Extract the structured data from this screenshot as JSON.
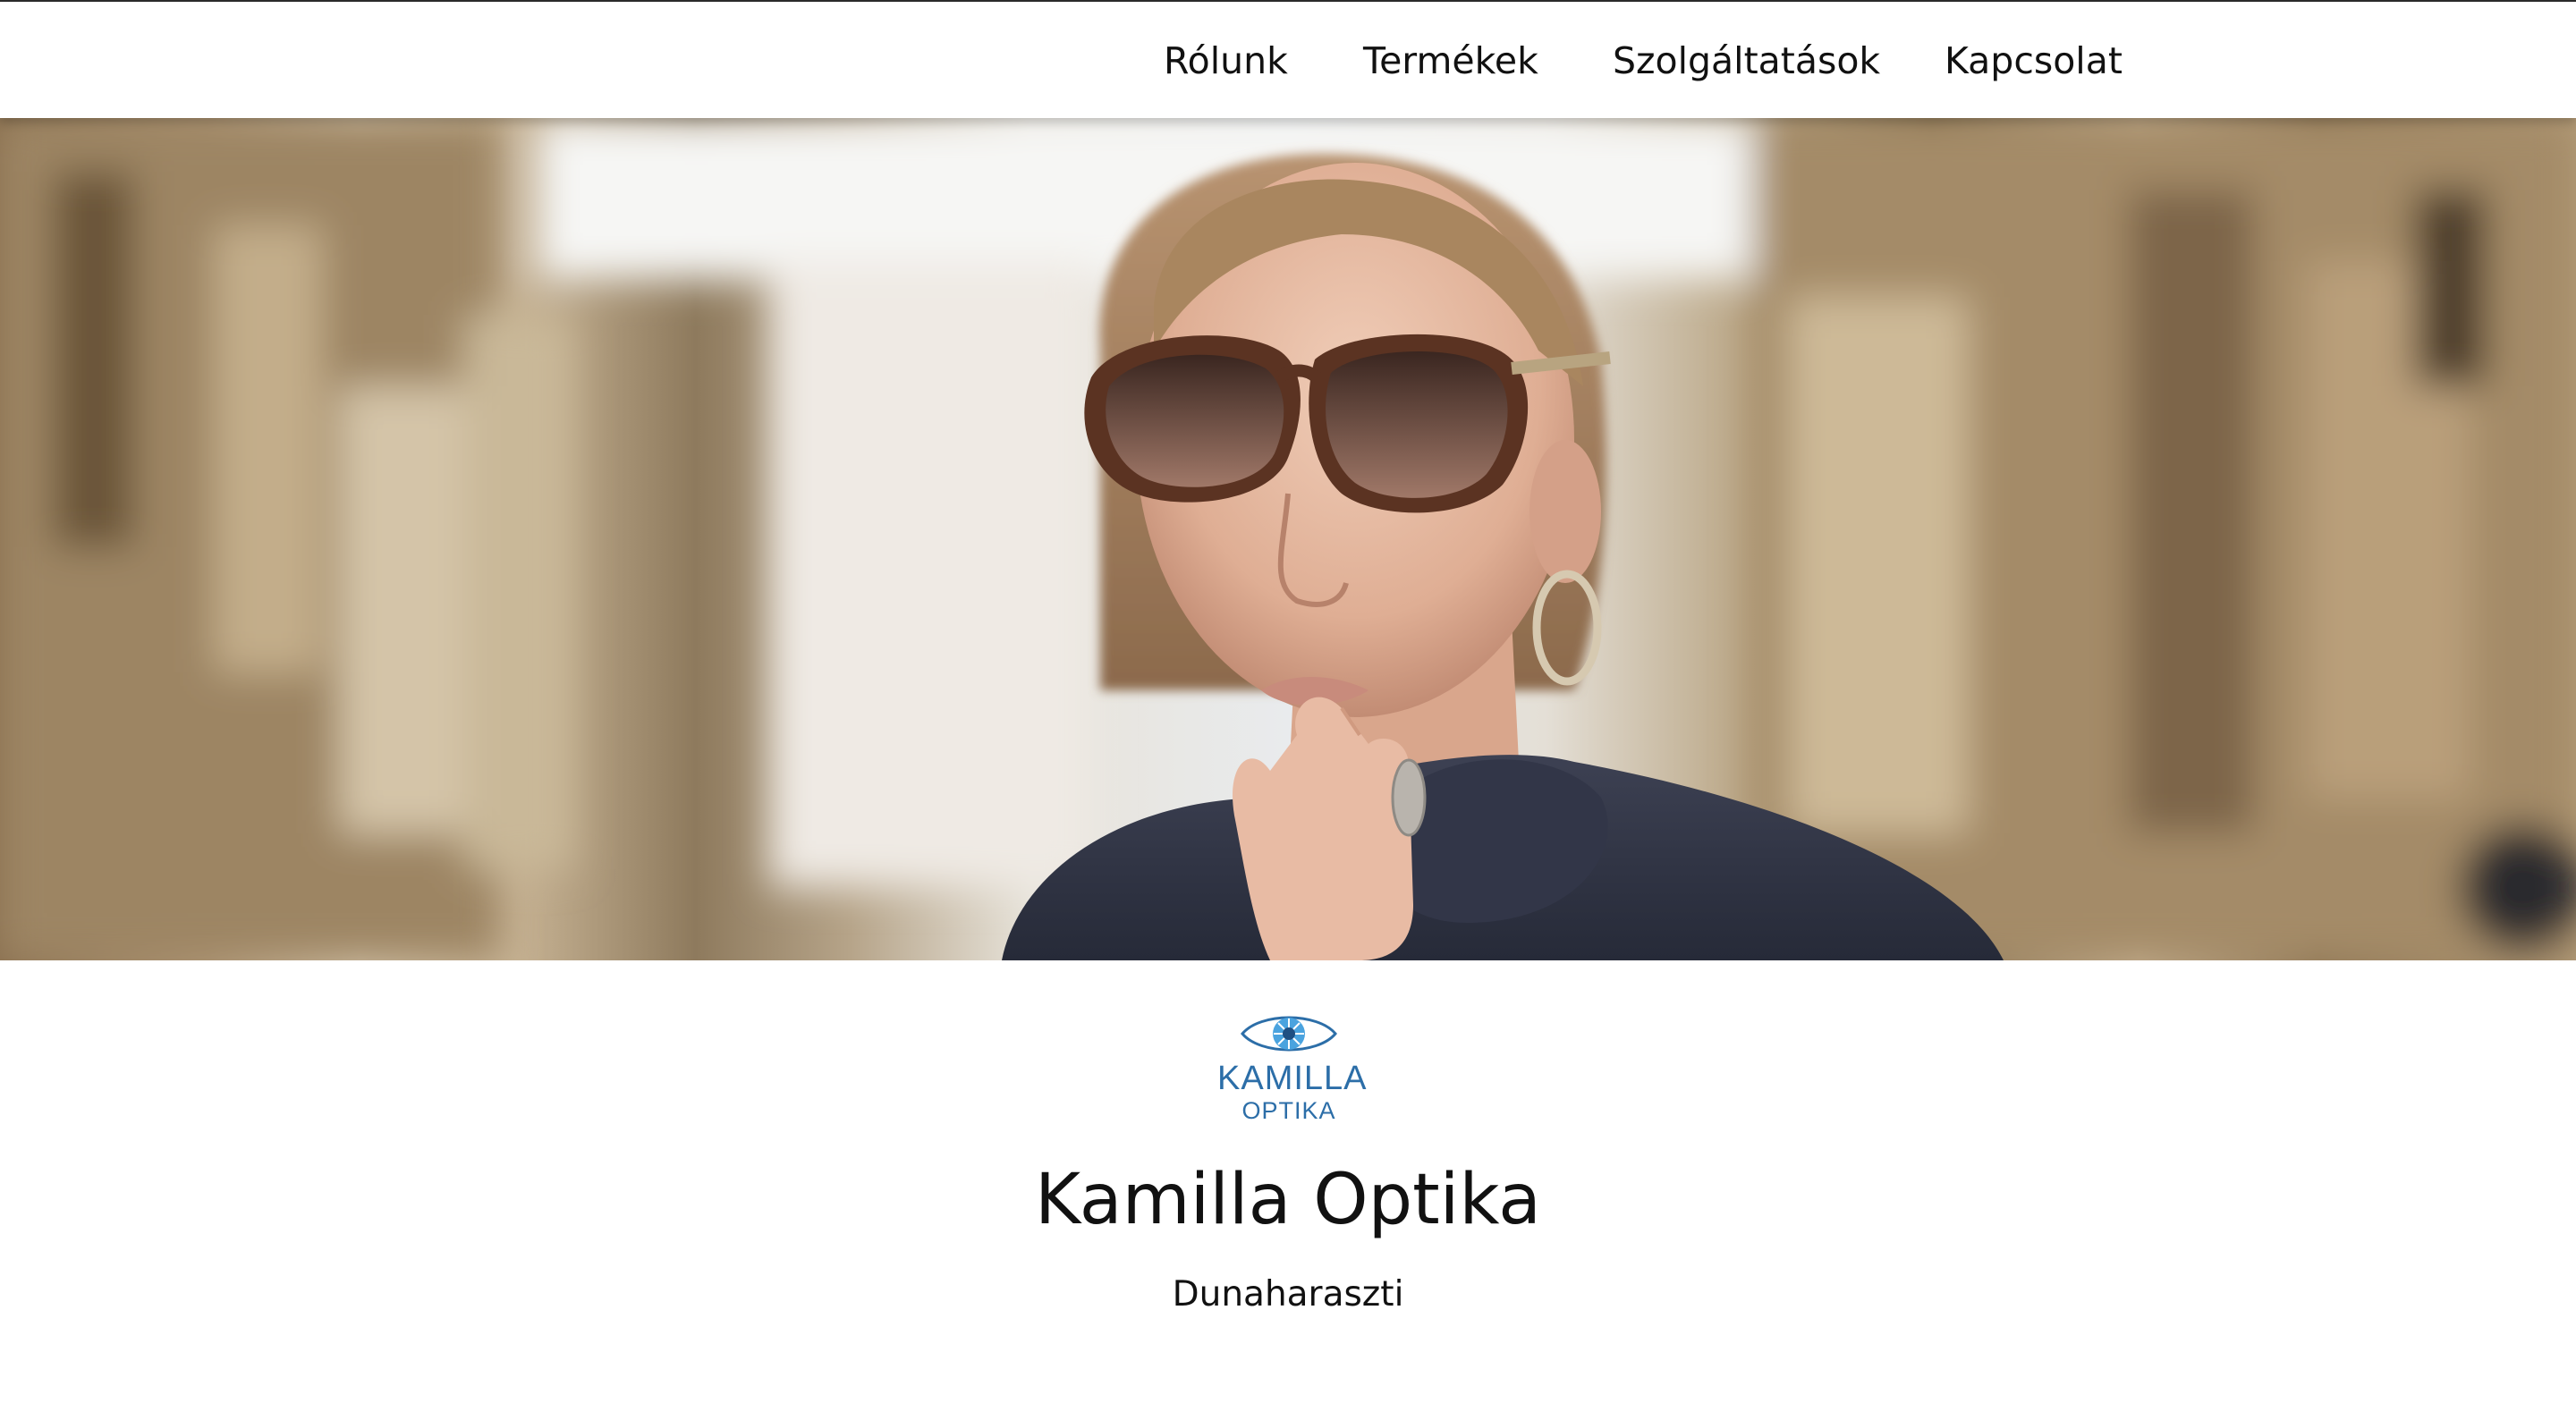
{
  "nav": {
    "items": [
      {
        "label": "Rólunk"
      },
      {
        "label": "Termékek"
      },
      {
        "label": "Szolgáltatások"
      },
      {
        "label": "Kapcsolat"
      }
    ]
  },
  "brand": {
    "logo_line_1": "KAMILLA",
    "logo_line_2": "OPTIKA",
    "title": "Kamilla Optika",
    "subtitle": "Dunaharaszti"
  },
  "hero": {
    "image_icon": "woman-sunglasses-photo"
  },
  "colors": {
    "logo_blue": "#2c6ea8",
    "logo_light_blue": "#4aa3df",
    "text": "#111111",
    "background": "#ffffff"
  }
}
